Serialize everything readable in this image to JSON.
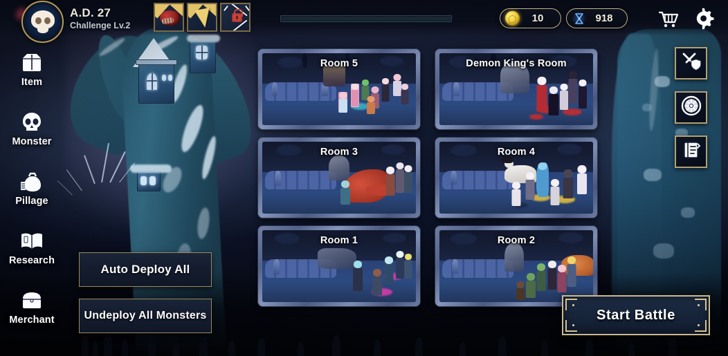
{
  "header": {
    "avatar_icon": "skull-avatar-icon",
    "era_title": "A.D. 27",
    "challenge_level": "Challenge Lv.2",
    "item_slots": [
      {
        "name": "meat-item",
        "icon": "red-meat-icon",
        "locked": false
      },
      {
        "name": "horn-item",
        "icon": "yellow-cone-icon",
        "locked": false
      },
      {
        "name": "locked-slot",
        "icon": "crossed-swords-lock-icon",
        "locked": true
      }
    ],
    "progress": {
      "label": "",
      "percent": 0
    },
    "currencies": [
      {
        "name": "gold",
        "icon": "gold-coin-icon",
        "value": "10"
      },
      {
        "name": "gem",
        "icon": "blue-hourglass-icon",
        "value": "918"
      }
    ],
    "cart_label": "cart-icon",
    "settings_label": "gear-icon"
  },
  "sidebar": {
    "items": [
      {
        "label": "Item",
        "icon": "bag-icon"
      },
      {
        "label": "Monster",
        "icon": "skull-icon"
      },
      {
        "label": "Pillage",
        "icon": "money-bag-icon"
      },
      {
        "label": "Research",
        "icon": "open-book-icon"
      },
      {
        "label": "Merchant",
        "icon": "treasure-chest-icon"
      }
    ]
  },
  "rooms": [
    {
      "title": "Room 5",
      "slot": "top-left"
    },
    {
      "title": "Demon King's Room",
      "slot": "top-right"
    },
    {
      "title": "Room 3",
      "slot": "mid-left"
    },
    {
      "title": "Room 4",
      "slot": "mid-right"
    },
    {
      "title": "Room 1",
      "slot": "bottom-left"
    },
    {
      "title": "Room 2",
      "slot": "bottom-right"
    }
  ],
  "right_rail": [
    {
      "name": "battle-formation-button",
      "icon": "sword-shield-icon"
    },
    {
      "name": "wheel-button",
      "icon": "wheel-icon"
    },
    {
      "name": "quest-log-button",
      "icon": "notebook-icon"
    }
  ],
  "actions": {
    "auto_deploy": "Auto Deploy All",
    "undeploy_all": "Undeploy All Monsters",
    "start_battle": "Start Battle"
  },
  "colors": {
    "gold_border": "#c3b187",
    "panel_bg": "#141c2e",
    "room_floor": "#2c4a80",
    "accent_text": "#ffffff",
    "coin_yellow": "#f1cf3c",
    "gem_blue": "#4b8ce8",
    "lock_red": "#c8453c"
  }
}
